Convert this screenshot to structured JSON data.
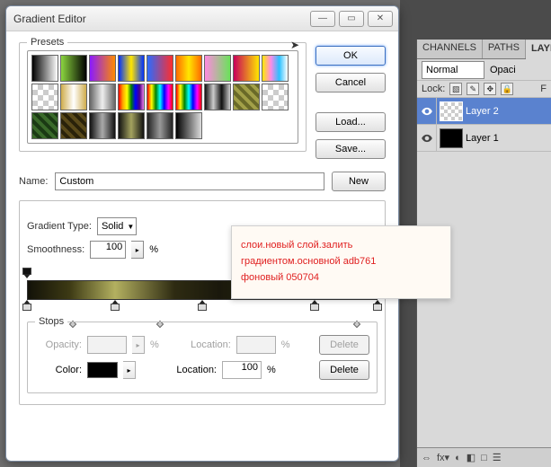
{
  "dialog": {
    "title": "Gradient Editor"
  },
  "presets": {
    "legend": "Presets"
  },
  "buttons": {
    "ok": "OK",
    "cancel": "Cancel",
    "load": "Load...",
    "save": "Save...",
    "new": "New",
    "delete": "Delete"
  },
  "name": {
    "label": "Name:",
    "value": "Custom"
  },
  "gradient_type": {
    "label": "Gradient Type:",
    "value": "Solid"
  },
  "smoothness": {
    "label": "Smoothness:",
    "value": "100",
    "unit": "%"
  },
  "preset_swatches": [
    "linear-gradient(90deg,#000,#fff)",
    "linear-gradient(90deg,#8cd63f,#000)",
    "linear-gradient(90deg,#8a1aff,#ff8a00)",
    "linear-gradient(90deg,#0030ff,#ffe600,#0030ff)",
    "linear-gradient(90deg,#2b6bff,#ff2d2d)",
    "linear-gradient(90deg,#ff6a00,#ffe600,#ff6a00)",
    "linear-gradient(90deg,#ff8ae0,#6ae25a)",
    "linear-gradient(90deg,#c8005a,#ffe600)",
    "linear-gradient(90deg,#ffeb00,#ff8ae6,#2bc1ff,#fff)",
    "chk",
    "linear-gradient(90deg,#cfac4c,#fff,#cfac4c)",
    "linear-gradient(90deg,#666,#eee,#666)",
    "linear-gradient(90deg,red,orange,yellow,green,blue,indigo,violet)",
    "linear-gradient(90deg,red,yellow,green,cyan,blue,magenta,red)",
    "linear-gradient(90deg,red,yellow,green,cyan,blue,magenta,red)",
    "linear-gradient(90deg,#111,#ccc,#111,#ccc)",
    "repeating-linear-gradient(45deg,#a2a048 0 4px,#6a6a28 4px 8px)",
    "chk",
    "repeating-linear-gradient(45deg,#3a6a2a 0 4px,#1b3a14 4px 8px)",
    "repeating-linear-gradient(45deg,#5a4a1a 0 4px,#2a220a 4px 8px)",
    "linear-gradient(90deg,#111,#aaa,#111)",
    "linear-gradient(90deg,#111,#a3a25f,#111)",
    "linear-gradient(90deg,#222,#999,#222)",
    "linear-gradient(90deg,#000,#ddd)"
  ],
  "stops": {
    "legend": "Stops",
    "opacity_label": "Opacity:",
    "opacity_value": "",
    "opacity_unit": "%",
    "location_label": "Location:",
    "location_value": "",
    "location_value2": "100",
    "location_unit": "%",
    "color_label": "Color:",
    "color_value": "#000000"
  },
  "opacity_stops_pct": [
    0,
    100
  ],
  "color_stops_pct": [
    0,
    25,
    50,
    82,
    100
  ],
  "midpoints_pct": [
    13,
    38,
    94
  ],
  "tip": {
    "l1": "слои.новый слой.залить",
    "l2": "градиентом.основной adb761",
    "l3": "фоновый 050704"
  },
  "panel": {
    "tabs": {
      "channels": "CHANNELS",
      "paths": "PATHS",
      "layers": "LAYER"
    },
    "mode": "Normal",
    "opacity_label": "Opaci",
    "lock_label": "Lock:",
    "fill_label": "F",
    "layers": [
      {
        "name": "Layer 2",
        "active": true,
        "thumb": "chk"
      },
      {
        "name": "Layer 1",
        "active": false,
        "thumb": "black"
      }
    ],
    "foot": [
      "⇔",
      "fx",
      "◐",
      "◧",
      "□",
      "☰"
    ]
  }
}
